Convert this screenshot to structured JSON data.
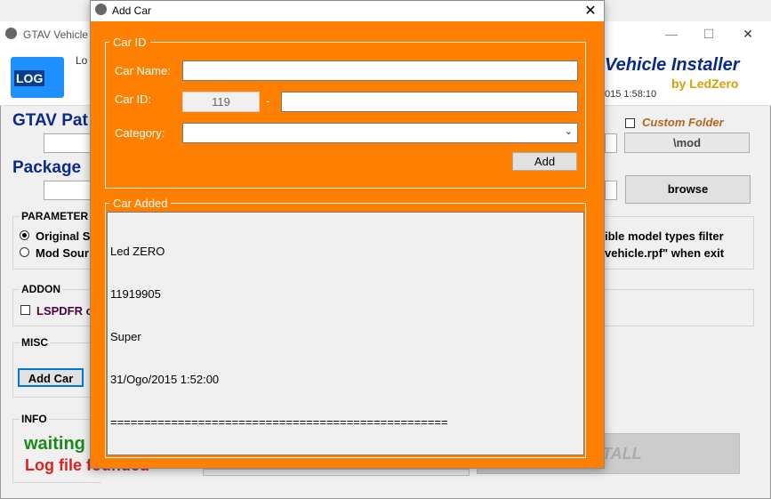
{
  "bg_window": {
    "title": "GTAV Vehicle Ir",
    "header_partial": "Lo",
    "logo_text": "LOG",
    "header_title": "Vehicle Installer",
    "header_by": "by LedZero",
    "header_time": "015 1:58:10",
    "gtav_path_label": "GTAV Pat",
    "package_label": "Package",
    "custom_folder_label": "Custom Folder",
    "mod_folder_value": "\\mod",
    "browse_label": "browse",
    "parameter_label": "PARAMETER",
    "radio_original": "Original S",
    "radio_mod": "Mod Sour",
    "filter_text": "ible model types filter",
    "exit_text": "vehicle.rpf\" when exit",
    "addon_label": "ADDON",
    "lspdfr_label": "LSPDFR c",
    "misc_label": "MISC",
    "add_car_button": "Add Car",
    "info_label": "INFO",
    "waiting_text": "waiting",
    "log_found_text": "Log file founded",
    "install_label": "TALL",
    "colors": {
      "waiting": "#1a8a1a",
      "log_found": "#e02020",
      "heading": "#0a2a8a"
    }
  },
  "dialog": {
    "title": "Add Car",
    "close_icon": "close-icon",
    "car_id_legend": "Car ID",
    "car_name_label": "Car Name:",
    "car_name_value": "",
    "car_id_label": "Car ID:",
    "car_id_number": "119",
    "car_id_separator": "-",
    "car_id_value": "",
    "category_label": "Category:",
    "category_value": "",
    "add_button": "Add",
    "car_added_legend": "Car Added",
    "log_lines": [
      "Led ZERO",
      "11919905",
      "Super",
      "31/Ogo/2015 1:52:00",
      "=================================================="
    ],
    "colors": {
      "background": "#ff8000"
    }
  }
}
